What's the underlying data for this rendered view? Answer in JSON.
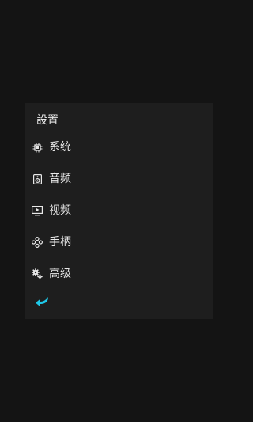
{
  "panel": {
    "title": "設置",
    "items": [
      {
        "label": "系统",
        "icon": "chip-icon"
      },
      {
        "label": "音频",
        "icon": "speaker-icon"
      },
      {
        "label": "视频",
        "icon": "monitor-icon"
      },
      {
        "label": "手柄",
        "icon": "gamepad-icon"
      },
      {
        "label": "高级",
        "icon": "gears-icon"
      }
    ],
    "back_icon": "back-arrow-icon"
  },
  "colors": {
    "background": "#141414",
    "panel": "#1e1e1e",
    "text": "#e8e8e8",
    "accent": "#1ec8e8"
  }
}
